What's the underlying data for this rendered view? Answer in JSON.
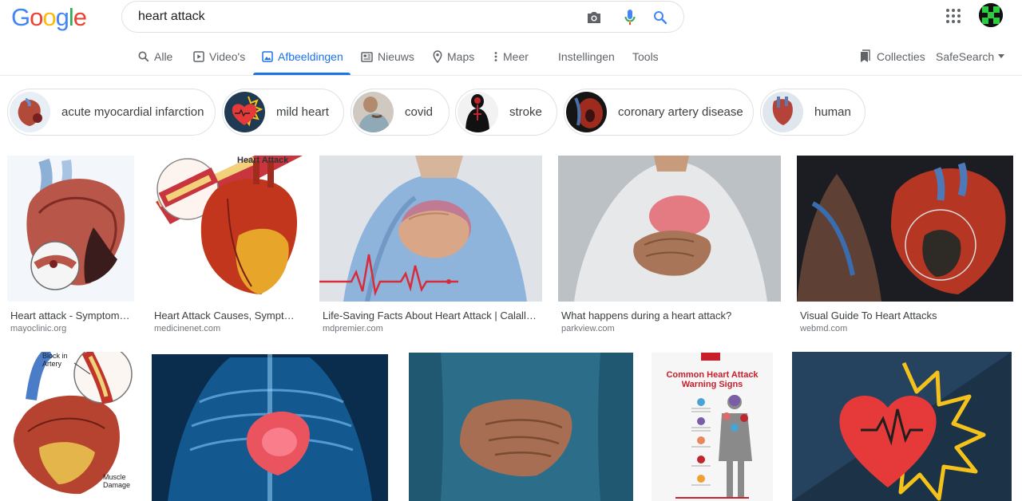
{
  "search": {
    "query": "heart attack"
  },
  "logo": {
    "letters": [
      "G",
      "o",
      "o",
      "g",
      "l",
      "e"
    ],
    "colors": [
      "#4285F4",
      "#EA4335",
      "#FBBC05",
      "#4285F4",
      "#34A853",
      "#EA4335"
    ]
  },
  "tabs": [
    {
      "label": "Alle",
      "icon": "search-icon"
    },
    {
      "label": "Video's",
      "icon": "video-icon"
    },
    {
      "label": "Afbeeldingen",
      "icon": "image-icon",
      "active": true
    },
    {
      "label": "Nieuws",
      "icon": "news-icon"
    },
    {
      "label": "Maps",
      "icon": "map-pin-icon"
    },
    {
      "label": "Meer",
      "icon": "more-vert-icon"
    },
    {
      "label": "Instellingen"
    },
    {
      "label": "Tools"
    }
  ],
  "right_tools": {
    "collections": "Collecties",
    "safesearch": "SafeSearch"
  },
  "chips": [
    {
      "label": "acute myocardial infarction"
    },
    {
      "label": "mild heart"
    },
    {
      "label": "covid"
    },
    {
      "label": "stroke"
    },
    {
      "label": "coronary artery disease"
    },
    {
      "label": "human"
    }
  ],
  "results_row1": [
    {
      "title": "Heart attack - Symptoms and causes - Mayo Clinic",
      "source": "mayoclinic.org"
    },
    {
      "title": "Heart Attack Causes, Symptoms, Treatment",
      "source": "medicinenet.com"
    },
    {
      "title": "Life-Saving Facts About Heart Attack | Calallen Family",
      "source": "mdpremier.com"
    },
    {
      "title": "What happens during a heart attack?",
      "source": "parkview.com"
    },
    {
      "title": "Visual Guide To Heart Attacks",
      "source": "webmd.com"
    }
  ],
  "image_text": {
    "heart_attack_heading": "Heart Attack",
    "block_in_artery": "Block in Artery",
    "muscle_damage": "Muscle Damage",
    "common_warning_signs": "Common Heart Attack Warning Signs"
  },
  "colors": {
    "accent": "#1a73e8",
    "muted": "#5f6368"
  }
}
